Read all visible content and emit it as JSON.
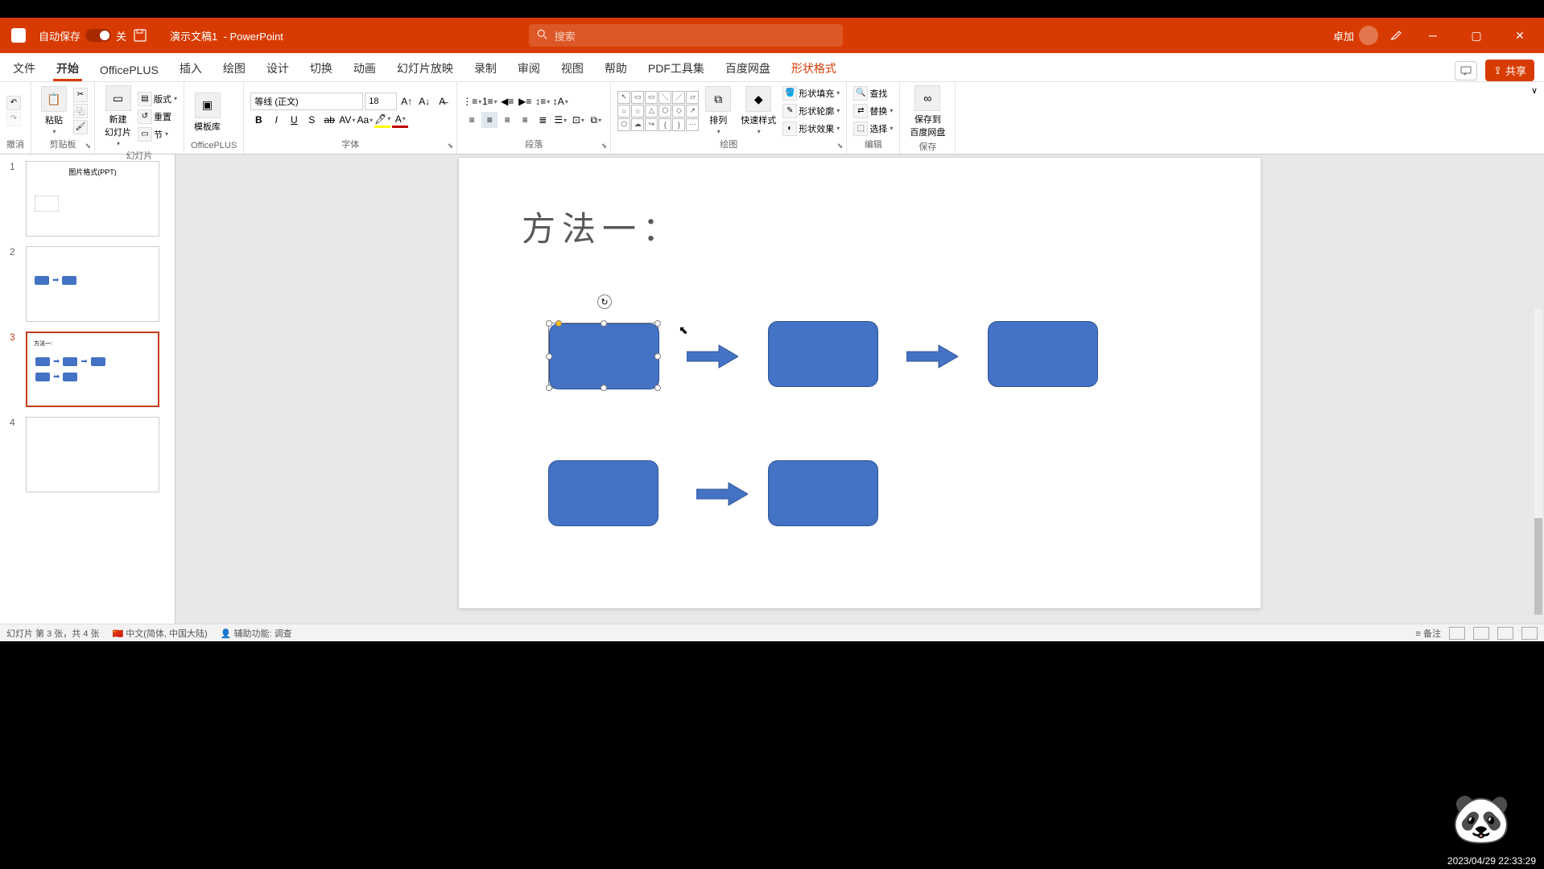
{
  "title_bar": {
    "autosave_label": "自动保存",
    "autosave_state": "关",
    "doc_title": "演示文稿1",
    "app_name": "PowerPoint",
    "search_placeholder": "搜索",
    "user_name": "卓加"
  },
  "tabs": {
    "file": "文件",
    "home": "开始",
    "officeplus": "OfficePLUS",
    "insert": "插入",
    "draw": "绘图",
    "design": "设计",
    "transitions": "切换",
    "animations": "动画",
    "slideshow": "幻灯片放映",
    "record": "录制",
    "review": "审阅",
    "view": "视图",
    "help": "帮助",
    "pdf": "PDF工具集",
    "baidu": "百度网盘",
    "shape_format": "形状格式",
    "share": "共享"
  },
  "ribbon": {
    "undo_group": "撤消",
    "clipboard_group": "剪贴板",
    "paste": "粘贴",
    "slides_group": "幻灯片",
    "new_slide": "新建\n幻灯片",
    "layout": "版式",
    "reset": "重置",
    "section": "节",
    "officeplus_group": "OfficePLUS",
    "template": "模板库",
    "font_group": "字体",
    "font_name": "等线 (正文)",
    "font_size": "18",
    "paragraph_group": "段落",
    "drawing_group": "绘图",
    "arrange": "排列",
    "quick_styles": "快速样式",
    "shape_fill": "形状填充",
    "shape_outline": "形状轮廓",
    "shape_effects": "形状效果",
    "editing_group": "编辑",
    "find": "查找",
    "replace": "替换",
    "select": "选择",
    "save_group": "保存",
    "save_to_baidu": "保存到\n百度网盘"
  },
  "thumbnails": {
    "t1_title": "图片格式(PPT)",
    "t3_title": "方法一:"
  },
  "slide": {
    "title": "方法一："
  },
  "status": {
    "slide_info": "幻灯片 第 3 张，共 4 张",
    "language": "中文(简体, 中国大陆)",
    "accessibility": "辅助功能: 调查",
    "notes": "备注"
  },
  "timestamp": "2023/04/29 22:33:29"
}
